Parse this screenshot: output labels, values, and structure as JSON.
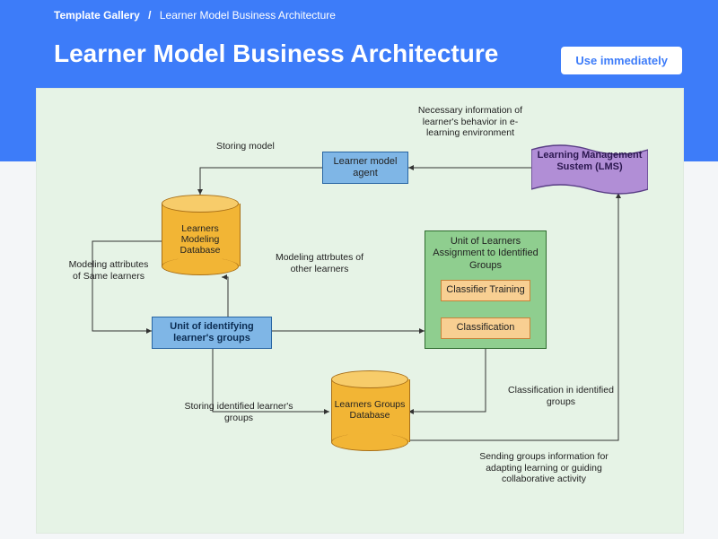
{
  "breadcrumb": {
    "root": "Template Gallery",
    "current": "Learner Model Business Architecture"
  },
  "page_title": "Learner Model Business Architecture",
  "use_button": "Use immediately",
  "nodes": {
    "learner_model_agent": "Learner model agent",
    "lms": "Learning Management Sustem (LMS)",
    "learners_modeling_db": "Learners Modeling Database",
    "unit_identify": "Unit of identifying learner's groups",
    "group_title": "Unit of Learners Assignment to Identified Groups",
    "classifier_training": "Classifier Training",
    "classification": "Classification",
    "learners_groups_db": "Learners Groups Database"
  },
  "annotations": {
    "storing_model": "Storing model",
    "necessary_info": "Necessary information of learner's behavior in e-learning environment",
    "modeling_same": "Modeling attributes of Same learners",
    "modeling_other": "Modeling attrbutes of other learners",
    "storing_groups": "Storing identified learner's groups",
    "classification_in": "Classification in identified groups",
    "sending_groups": "Sending groups information for adapting learning or guiding collaborative activity"
  }
}
